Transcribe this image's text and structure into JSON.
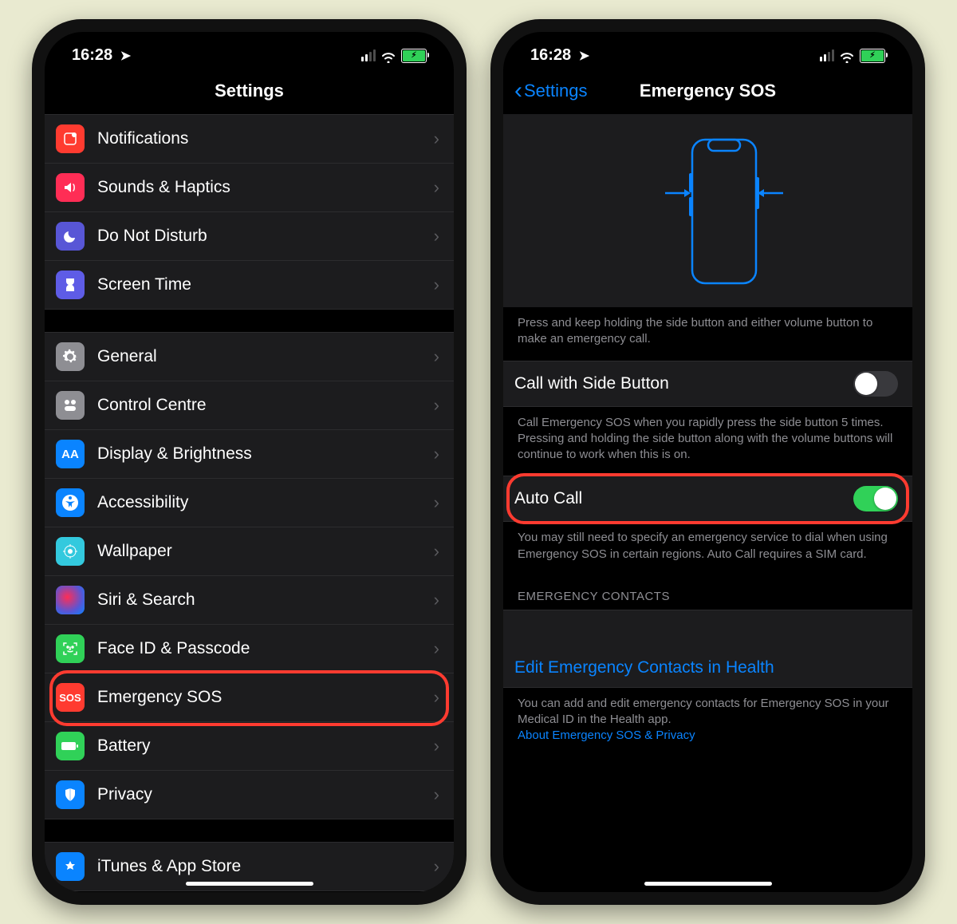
{
  "statusbar": {
    "time": "16:28",
    "location_glyph": "➤",
    "battery_bolt": "⚡︎"
  },
  "left": {
    "title": "Settings",
    "rows": {
      "notifications": "Notifications",
      "sounds": "Sounds & Haptics",
      "dnd": "Do Not Disturb",
      "screentime": "Screen Time",
      "general": "General",
      "control": "Control Centre",
      "display": "Display & Brightness",
      "display_glyph": "AA",
      "accessibility": "Accessibility",
      "wallpaper": "Wallpaper",
      "siri": "Siri & Search",
      "faceid": "Face ID & Passcode",
      "sos": "Emergency SOS",
      "sos_glyph": "SOS",
      "battery": "Battery",
      "privacy": "Privacy",
      "itunes": "iTunes & App Store"
    }
  },
  "right": {
    "back": "Settings",
    "title": "Emergency SOS",
    "hero_footer": "Press and keep holding the side button and either volume button to make an emergency call.",
    "call_side": "Call with Side Button",
    "call_side_on": false,
    "call_side_footer": "Call Emergency SOS when you rapidly press the side button 5 times. Pressing and holding the side button along with the volume buttons will continue to work when this is on.",
    "auto_call": "Auto Call",
    "auto_call_on": true,
    "auto_call_footer": "You may still need to specify an emergency service to dial when using Emergency SOS in certain regions. Auto Call requires a SIM card.",
    "contacts_header": "EMERGENCY CONTACTS",
    "edit_link": "Edit Emergency Contacts in Health",
    "contacts_footer": "You can add and edit emergency contacts for Emergency SOS in your Medical ID in the Health app.",
    "privacy_link": "About Emergency SOS & Privacy"
  }
}
